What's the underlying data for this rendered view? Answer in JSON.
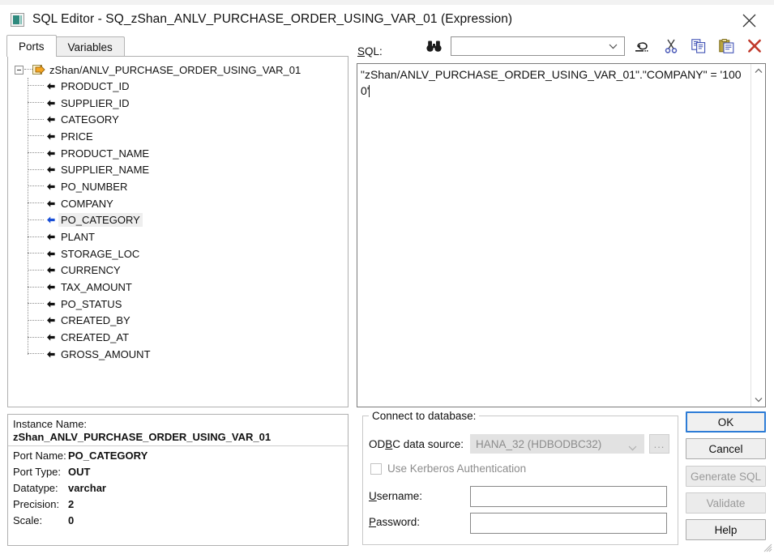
{
  "window": {
    "title": "SQL Editor - SQ_zShan_ANLV_PURCHASE_ORDER_USING_VAR_01 (Expression)",
    "close_icon": "close-icon",
    "app_icon": "sql-editor-window-icon"
  },
  "tabs": [
    {
      "label": "Ports",
      "active": true
    },
    {
      "label": "Variables",
      "active": false
    }
  ],
  "tree": {
    "root_label": "zShan/ANLV_PURCHASE_ORDER_USING_VAR_01",
    "root_icon": "output-group-icon",
    "expander_state": "expanded",
    "items": [
      {
        "label": "PRODUCT_ID",
        "selected": false,
        "icon": "port-arrow-icon"
      },
      {
        "label": "SUPPLIER_ID",
        "selected": false,
        "icon": "port-arrow-icon"
      },
      {
        "label": "CATEGORY",
        "selected": false,
        "icon": "port-arrow-icon"
      },
      {
        "label": "PRICE",
        "selected": false,
        "icon": "port-arrow-icon"
      },
      {
        "label": "PRODUCT_NAME",
        "selected": false,
        "icon": "port-arrow-icon"
      },
      {
        "label": "SUPPLIER_NAME",
        "selected": false,
        "icon": "port-arrow-icon"
      },
      {
        "label": "PO_NUMBER",
        "selected": false,
        "icon": "port-arrow-icon"
      },
      {
        "label": "COMPANY",
        "selected": false,
        "icon": "port-arrow-icon"
      },
      {
        "label": "PO_CATEGORY",
        "selected": true,
        "icon": "port-arrow-icon"
      },
      {
        "label": "PLANT",
        "selected": false,
        "icon": "port-arrow-icon"
      },
      {
        "label": "STORAGE_LOC",
        "selected": false,
        "icon": "port-arrow-icon"
      },
      {
        "label": "CURRENCY",
        "selected": false,
        "icon": "port-arrow-icon"
      },
      {
        "label": "TAX_AMOUNT",
        "selected": false,
        "icon": "port-arrow-icon"
      },
      {
        "label": "PO_STATUS",
        "selected": false,
        "icon": "port-arrow-icon"
      },
      {
        "label": "CREATED_BY",
        "selected": false,
        "icon": "port-arrow-icon"
      },
      {
        "label": "CREATED_AT",
        "selected": false,
        "icon": "port-arrow-icon"
      },
      {
        "label": "GROSS_AMOUNT",
        "selected": false,
        "icon": "port-arrow-icon"
      }
    ]
  },
  "instance_panel": {
    "instance_name_label": "Instance Name:",
    "instance_name_value": "zShan_ANLV_PURCHASE_ORDER_USING_VAR_01",
    "rows": [
      {
        "key": "Port Name:",
        "value": "PO_CATEGORY"
      },
      {
        "key": "Port Type:",
        "value": "OUT"
      },
      {
        "key": "Datatype:",
        "value": "varchar"
      },
      {
        "key": "Precision:",
        "value": "2"
      },
      {
        "key": "Scale:",
        "value": "0"
      }
    ]
  },
  "sql_editor": {
    "label": "SQL:",
    "find_icon": "binoculars-find-icon",
    "combo_value": "",
    "combo_placeholder": "",
    "toolbar": [
      {
        "name": "undo-button",
        "icon": "undo-arrow-icon",
        "title": "Undo"
      },
      {
        "name": "cut-button",
        "icon": "scissors-cut-icon",
        "title": "Cut"
      },
      {
        "name": "copy-button",
        "icon": "copy-pages-icon",
        "title": "Copy"
      },
      {
        "name": "paste-button",
        "icon": "clipboard-paste-icon",
        "title": "Paste"
      },
      {
        "name": "delete-button",
        "icon": "red-x-delete-icon",
        "title": "Delete"
      }
    ],
    "text": "\"zShan/ANLV_PURCHASE_ORDER_USING_VAR_01\".\"COMPANY\" = '1000'",
    "scroll_up_icon": "chevron-up-icon",
    "scroll_down_icon": "chevron-down-icon"
  },
  "connect_group": {
    "title": "Connect to database:",
    "odbc_label": "ODBC data source:",
    "odbc_label_mnemonic": "B",
    "odbc_value": "HANA_32 (HDBODBC32)",
    "odbc_disabled": true,
    "browse_button_label": "...",
    "kerberos_label": "Use Kerberos Authentication",
    "kerberos_checked": false,
    "kerberos_disabled": true,
    "username_label": "Username:",
    "username_value": "",
    "password_label": "Password:",
    "password_value": ""
  },
  "buttons": [
    {
      "label": "OK",
      "state": "default-focused"
    },
    {
      "label": "Cancel",
      "state": "enabled"
    },
    {
      "label": "Generate SQL",
      "state": "disabled"
    },
    {
      "label": "Validate",
      "state": "disabled"
    },
    {
      "label": "Help",
      "state": "enabled"
    }
  ],
  "colors": {
    "accent_focus": "#2d7cd6",
    "selected_port_arrow": "#1a4fd6",
    "delete_x": "#c0392b",
    "title_icon": "#2f8a7e"
  }
}
